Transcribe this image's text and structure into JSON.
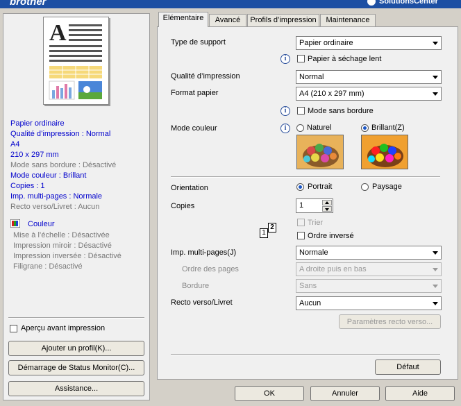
{
  "window": {
    "brand": "brother",
    "solutions_center": "SolutionsCenter"
  },
  "summary": {
    "lines": [
      {
        "text": "Papier ordinaire",
        "color": "blue"
      },
      {
        "text": "Qualité d’impression : Normal",
        "color": "blue"
      },
      {
        "text": "A4",
        "color": "blue"
      },
      {
        "text": "210 x 297 mm",
        "color": "blue"
      },
      {
        "text": "Mode sans bordure : Désactivé",
        "color": "gray"
      },
      {
        "text": "Mode couleur : Brillant",
        "color": "blue"
      },
      {
        "text": "Copies : 1",
        "color": "blue"
      },
      {
        "text": "Imp. multi-pages : Normale",
        "color": "blue"
      },
      {
        "text": "Recto verso/Livret : Aucun",
        "color": "gray"
      }
    ],
    "color_label": "Couleur",
    "extra_lines": [
      "Mise à l’échelle : Désactivée",
      "Impression miroir : Désactivé",
      "Impression inversée : Désactivé",
      "Filigrane : Désactivé"
    ]
  },
  "left_controls": {
    "preview_checkbox": "Aperçu avant impression",
    "add_profile": "Ajouter un profil(K)...",
    "status_monitor": "Démarrage de Status Monitor(C)...",
    "assistance": "Assistance..."
  },
  "tabs": [
    "Elémentaire",
    "Avancé",
    "Profils d’impression",
    "Maintenance"
  ],
  "basic": {
    "media_type_label": "Type de support",
    "media_type_value": "Papier ordinaire",
    "slow_dry_label": "Papier à séchage lent",
    "quality_label": "Qualité d’impression",
    "quality_value": "Normal",
    "paper_size_label": "Format papier",
    "paper_size_value": "A4 (210 x 297 mm)",
    "borderless_label": "Mode sans bordure",
    "color_mode_label": "Mode couleur",
    "natural_label": "Naturel",
    "vivid_label": "Brillant(Z)",
    "orientation_label": "Orientation",
    "portrait_label": "Portrait",
    "landscape_label": "Paysage",
    "copies_label": "Copies",
    "copies_value": "1",
    "collate_label": "Trier",
    "reverse_label": "Ordre inversé",
    "multipage_label": "Imp. multi-pages(J)",
    "multipage_value": "Normale",
    "page_order_label": "Ordre des pages",
    "page_order_value": "A droite puis en bas",
    "border_label": "Bordure",
    "border_value": "Sans",
    "duplex_label": "Recto verso/Livret",
    "duplex_value": "Aucun",
    "duplex_settings": "Paramètres recto verso...",
    "default_button": "Défaut"
  },
  "footer": {
    "ok": "OK",
    "cancel": "Annuler",
    "help": "Aide"
  },
  "icons": {
    "info": "i",
    "copies_icon_1": "1",
    "copies_icon_2": "2"
  }
}
